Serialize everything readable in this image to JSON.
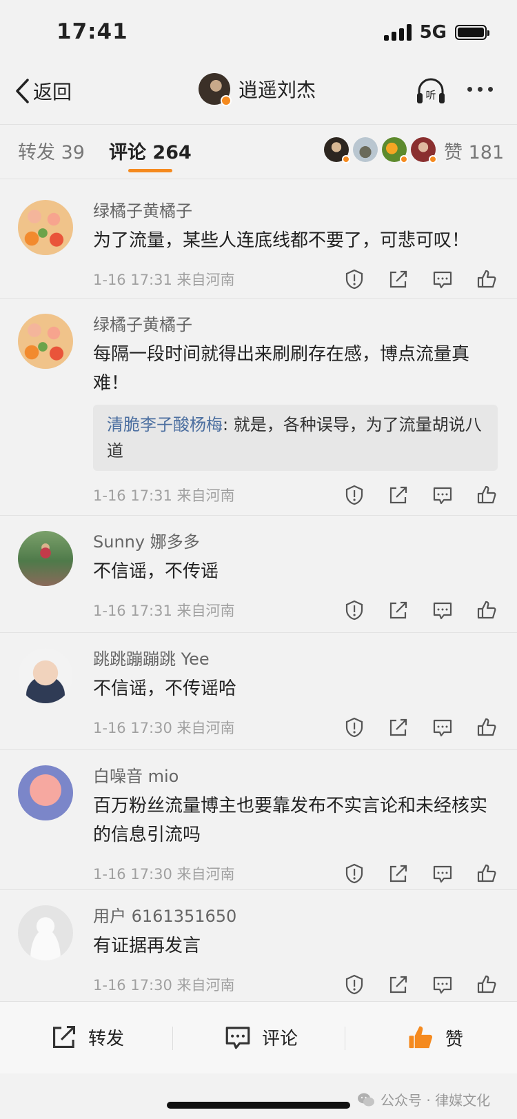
{
  "status": {
    "time": "17:41",
    "network": "5G"
  },
  "nav": {
    "back_label": "返回",
    "author_name": "逍遥刘杰"
  },
  "tabs": {
    "repost_label": "转发",
    "repost_count": "39",
    "comment_label": "评论",
    "comment_count": "264",
    "like_label": "赞",
    "like_count": "181"
  },
  "colors": {
    "accent": "#f58a1f",
    "quote_name": "#4c6fa0",
    "like_active": "#f58a1f"
  },
  "comments": [
    {
      "user": "绿橘子黄橘子",
      "text": "为了流量，某些人连底线都不要了，可悲可叹！",
      "time": "1-16 17:31",
      "location": "来自河南"
    },
    {
      "user": "绿橘子黄橘子",
      "text": "每隔一段时间就得出来刷刷存在感，博点流量真难！",
      "quote_name": "清脆李子酸杨梅",
      "quote_text": ": 就是，各种误导，为了流量胡说八道",
      "time": "1-16 17:31",
      "location": "来自河南"
    },
    {
      "user": "Sunny 娜多多",
      "text": "不信谣，不传谣",
      "time": "1-16 17:31",
      "location": "来自河南"
    },
    {
      "user": "跳跳蹦蹦跳 Yee",
      "text": "不信谣，不传谣哈",
      "time": "1-16 17:30",
      "location": "来自河南"
    },
    {
      "user": "白噪音 mio",
      "text": "百万粉丝流量博主也要靠发布不实言论和未经核实的信息引流吗",
      "time": "1-16 17:30",
      "location": "来自河南"
    },
    {
      "user": "用户 6161351650",
      "text": "有证据再发言",
      "time": "1-16 17:30",
      "location": "来自河南"
    }
  ],
  "bottom": {
    "repost": "转发",
    "comment": "评论",
    "like": "赞"
  },
  "watermark": "公众号 · 律媒文化",
  "icons": [
    "back-chevron-icon",
    "headphones-icon",
    "more-icon",
    "report-icon",
    "repost-icon",
    "comment-icon",
    "like-icon",
    "wechat-icon"
  ]
}
